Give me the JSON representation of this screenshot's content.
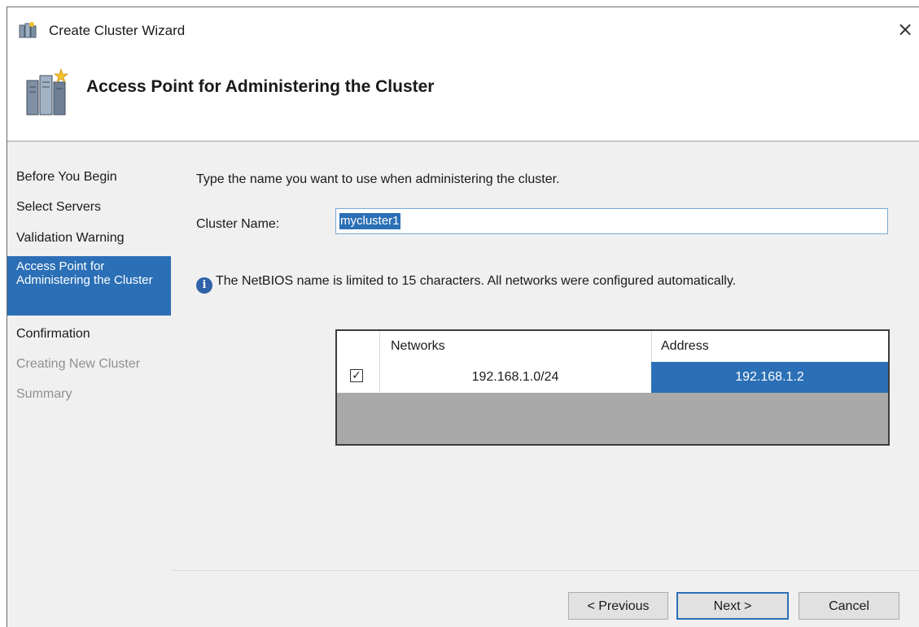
{
  "window": {
    "title": "Create Cluster Wizard",
    "close_label": "×"
  },
  "header": {
    "title": "Access Point for Administering the Cluster"
  },
  "sidebar": {
    "items": [
      {
        "label": "Before You Begin",
        "state": "normal"
      },
      {
        "label": "Select Servers",
        "state": "normal"
      },
      {
        "label": "Validation Warning",
        "state": "normal"
      },
      {
        "label": "Access Point for Administering the Cluster",
        "state": "active"
      },
      {
        "label": "Confirmation",
        "state": "normal"
      },
      {
        "label": "Creating New Cluster",
        "state": "disabled"
      },
      {
        "label": "Summary",
        "state": "disabled"
      }
    ]
  },
  "main": {
    "instruction": "Type the name you want to use when administering the cluster.",
    "cluster_name_label": "Cluster Name:",
    "cluster_name_value": "mycluster1",
    "info_icon": "i",
    "info_text": "The NetBIOS name is limited to 15 characters.  All networks were configured automatically.",
    "grid": {
      "headers": {
        "networks": "Networks",
        "address": "Address"
      },
      "rows": [
        {
          "checked": true,
          "check_glyph": "✓",
          "network": "192.168.1.0/24",
          "address": "192.168.1.2"
        }
      ]
    }
  },
  "footer": {
    "previous_label": "< Previous",
    "next_label": "Next >",
    "cancel_label": "Cancel"
  },
  "colors": {
    "accent": "#2b6fb6",
    "panel": "#f0f0f0",
    "grid_empty": "#a9a9a9"
  }
}
